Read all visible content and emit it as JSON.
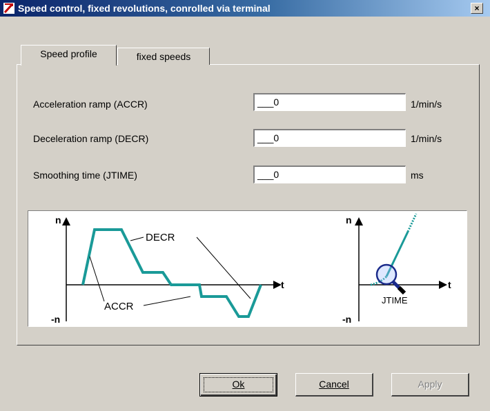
{
  "window": {
    "title": "Speed control, fixed revolutions, conrolled via terminal",
    "close_label": "×"
  },
  "tabs": [
    {
      "label": "Speed profile",
      "active": true
    },
    {
      "label": "fixed speeds",
      "active": false
    }
  ],
  "fields": [
    {
      "label": "Acceleration ramp (ACCR)",
      "value": "___0",
      "unit": "1/min/s"
    },
    {
      "label": "Deceleration ramp (DECR)",
      "value": "___0",
      "unit": "1/min/s"
    },
    {
      "label": "Smoothing time (JTIME)",
      "value": "___0",
      "unit": "ms"
    }
  ],
  "diagram": {
    "left": {
      "n_label": "n",
      "neg_n_label": "-n",
      "t_label": "t",
      "decr_label": "DECR",
      "accr_label": "ACCR"
    },
    "right": {
      "n_label": "n",
      "neg_n_label": "-n",
      "t_label": "t",
      "jtime_label": "JTIME"
    },
    "curve_color": "#1a9a98"
  },
  "buttons": {
    "ok": "Ok",
    "cancel": "Cancel",
    "apply": "Apply"
  }
}
